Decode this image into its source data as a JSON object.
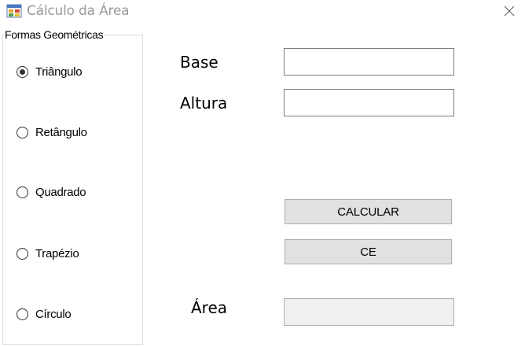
{
  "window": {
    "title": "Cálculo da Área",
    "icon": "form-window-icon",
    "close_icon": "close-icon"
  },
  "shapes_group": {
    "title": "Formas Geométricas",
    "options": [
      {
        "label": "Triângulo",
        "checked": true
      },
      {
        "label": "Retângulo",
        "checked": false
      },
      {
        "label": "Quadrado",
        "checked": false
      },
      {
        "label": "Trapézio",
        "checked": false
      },
      {
        "label": "Círculo",
        "checked": false
      }
    ]
  },
  "fields": {
    "base_label": "Base",
    "base_value": "",
    "altura_label": "Altura",
    "altura_value": "",
    "area_label": "Área",
    "area_value": ""
  },
  "buttons": {
    "calcular": "CALCULAR",
    "ce": "CE"
  },
  "colors": {
    "title_text": "#9a9a9a",
    "button_bg": "#e1e1e1",
    "readonly_bg": "#f0f0f0"
  }
}
